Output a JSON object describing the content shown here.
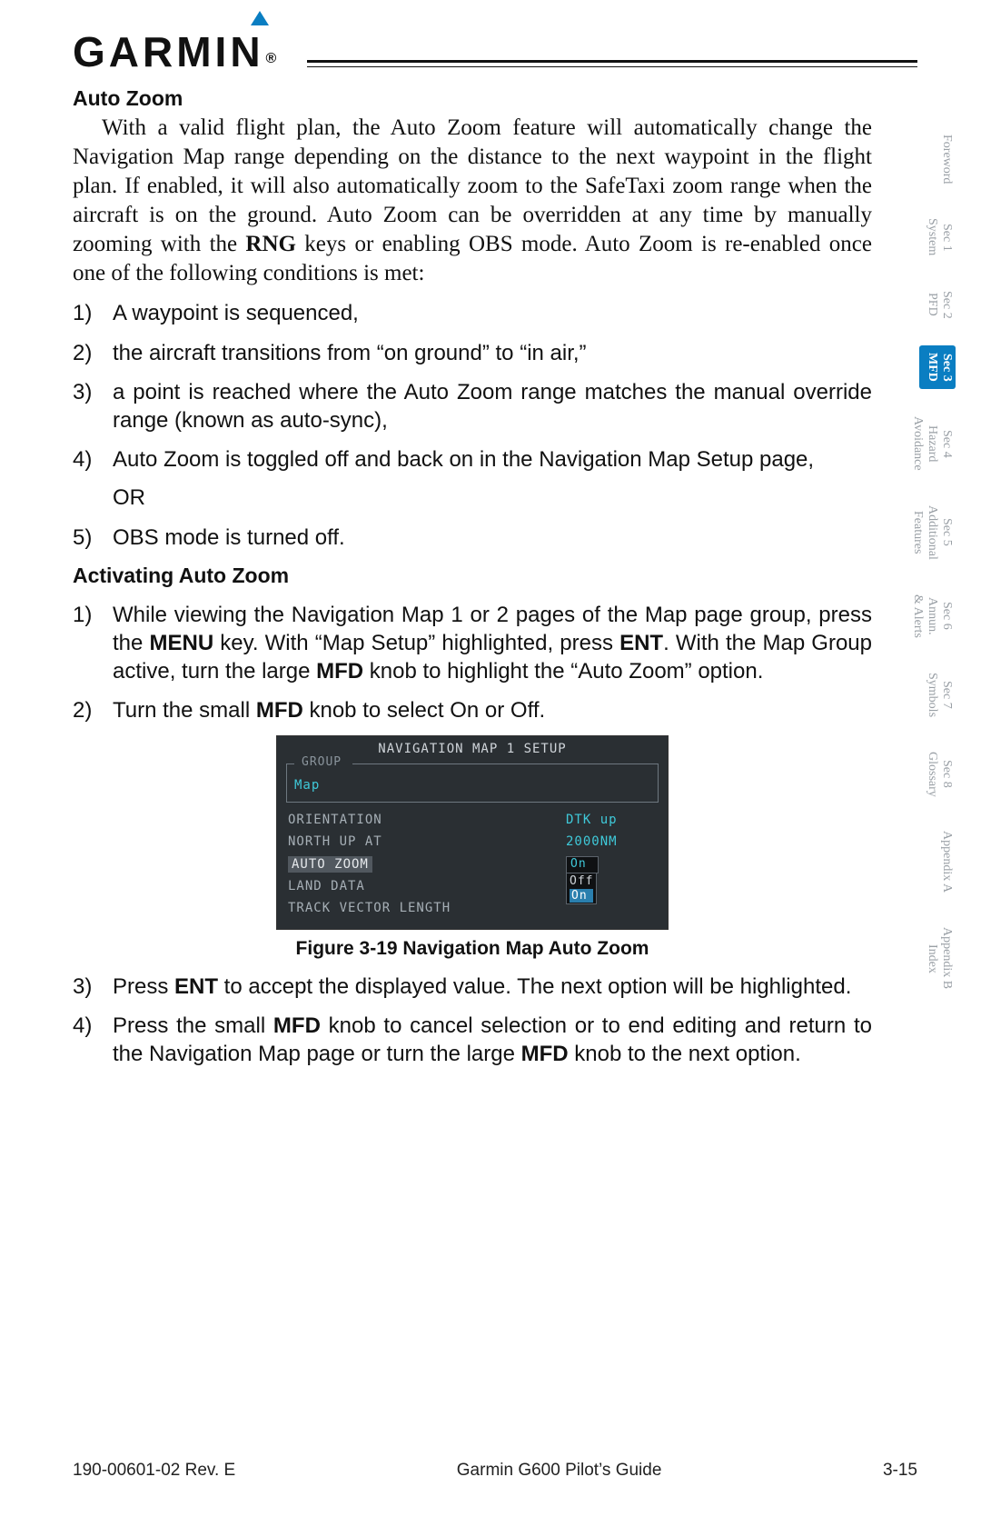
{
  "logo_text": "GARMIN",
  "section1_title": "Auto Zoom",
  "section1_para_parts": {
    "p1": "With a valid flight plan, the Auto Zoom feature will automatically change the Navigation Map range depending on the distance to the next waypoint in the flight plan. If enabled, it will also automatically zoom to the SafeTaxi zoom range when the aircraft is on the ground. Auto Zoom can be overridden at any time by manually zooming with the ",
    "p2": "RNG",
    "p3": " keys or enabling OBS mode. Auto Zoom is re-enabled once one of the following conditions is met:"
  },
  "list1": [
    {
      "n": "1)",
      "t": "A waypoint is sequenced,"
    },
    {
      "n": "2)",
      "t": "the aircraft transitions from “on ground” to “in air,”"
    },
    {
      "n": "3)",
      "t": "a point is reached where the Auto Zoom range matches the manual override range (known as auto-sync),"
    },
    {
      "n": "4)",
      "t": "Auto Zoom is toggled off and back on in the Navigation Map Setup page,"
    }
  ],
  "list1_or": "OR",
  "list1_item5": {
    "n": "5)",
    "t": "OBS mode is turned off."
  },
  "section2_title": "Activating Auto Zoom",
  "section2_step1": {
    "n": "1)",
    "p1": "While viewing the Navigation Map 1 or 2 pages of the Map page group, press the ",
    "b1": "MENU",
    "p2": " key. With “Map Setup” highlighted, press ",
    "b2": "ENT",
    "p3": ". With the Map Group active, turn the large ",
    "b3": "MFD",
    "p4": " knob to highlight the “Auto Zoom” option."
  },
  "section2_step2": {
    "n": "2)",
    "p1": "Turn the small ",
    "b1": "MFD",
    "p2": " knob to select On or Off."
  },
  "screenshot": {
    "title": "NAVIGATION MAP 1 SETUP",
    "group_label": "GROUP",
    "group_value": "Map",
    "rows": [
      {
        "label": "ORIENTATION",
        "value": "DTK up"
      },
      {
        "label": "NORTH UP AT",
        "value": "2000NM"
      },
      {
        "label": "AUTO ZOOM",
        "value": "On",
        "selected": true,
        "boxed": true,
        "dropdown": [
          "Off",
          "On"
        ],
        "dropdown_hl": "On"
      },
      {
        "label": "LAND DATA",
        "value": ""
      },
      {
        "label": "TRACK VECTOR LENGTH",
        "value": ""
      }
    ]
  },
  "caption": "Figure 3-19  Navigation Map Auto Zoom",
  "section2_step3": {
    "n": "3)",
    "p1": "Press ",
    "b1": "ENT",
    "p2": " to accept the displayed value. The next option will be highlighted."
  },
  "section2_step4": {
    "n": "4)",
    "p1": "Press the small ",
    "b1": "MFD",
    "p2": " knob to cancel selection or to end editing and return to the Navigation Map page or turn the large ",
    "b2": "MFD",
    "p3": " knob to the next option."
  },
  "side_tabs": [
    {
      "label": "Foreword"
    },
    {
      "label": "Sec 1\nSystem"
    },
    {
      "label": "Sec 2\nPFD"
    },
    {
      "label": "Sec 3\nMFD",
      "active": true
    },
    {
      "label": "Sec 4\nHazard\nAvoidance"
    },
    {
      "label": "Sec 5\nAdditional\nFeatures"
    },
    {
      "label": "Sec 6\nAnnun.\n& Alerts"
    },
    {
      "label": "Sec 7\nSymbols"
    },
    {
      "label": "Sec 8\nGlossary"
    },
    {
      "label": "Appendix A"
    },
    {
      "label": "Appendix B\nIndex"
    }
  ],
  "footer": {
    "left": "190-00601-02  Rev. E",
    "center": "Garmin G600 Pilot’s Guide",
    "right": "3-15"
  }
}
